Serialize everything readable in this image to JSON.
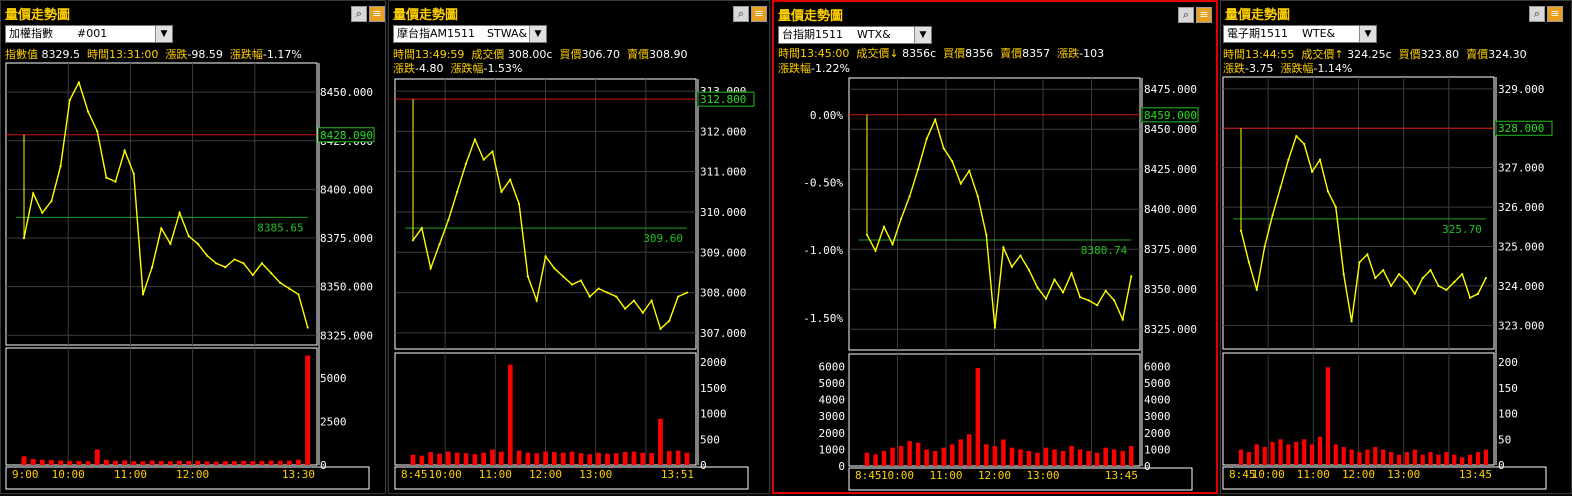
{
  "panels": [
    {
      "title": "量價走勢圖",
      "selector": {
        "name": "加權指數",
        "symbol": "#001"
      },
      "info_line1": [
        {
          "label": "指數值",
          "value": "8329.5"
        },
        {
          "label": "時間",
          "value": "13:31:00"
        },
        {
          "label": "漲跌",
          "value": "-98.59"
        },
        {
          "label": "漲跌幅",
          "value": "-1.17%"
        }
      ],
      "info_line2": [],
      "price_ticks": [
        "8450.000",
        "8425.000",
        "8400.000",
        "8375.000",
        "8350.000",
        "8325.000"
      ],
      "ref_label": "8428.090",
      "avg_label": "8385.65",
      "volume_ticks": [
        "5000",
        "2500",
        "0"
      ],
      "time_labels": [
        "9:00",
        "10:00",
        "11:00",
        "12:00",
        "13:30"
      ]
    },
    {
      "title": "量價走勢圖",
      "selector": {
        "name": "摩台指AM1511",
        "symbol": "STWA&"
      },
      "info_line1": [
        {
          "label": "時間",
          "value": "13:49:59"
        },
        {
          "label": "成交價",
          "value": "308.00c"
        },
        {
          "label": "買價",
          "value": "306.70"
        },
        {
          "label": "賣價",
          "value": "308.90"
        }
      ],
      "info_line2": [
        {
          "label": "漲跌",
          "value": "-4.80"
        },
        {
          "label": "漲跌幅",
          "value": "-1.53%"
        }
      ],
      "price_ticks": [
        "313.000",
        "312.000",
        "311.000",
        "310.000",
        "309.000",
        "308.000",
        "307.000"
      ],
      "ref_label": "312.800",
      "avg_label": "309.60",
      "volume_ticks": [
        "2000",
        "1500",
        "1000",
        "500",
        "0"
      ],
      "time_labels": [
        "8:45",
        "10:00",
        "11:00",
        "12:00",
        "13:00",
        "13:51"
      ]
    },
    {
      "title": "量價走勢圖",
      "selector": {
        "name": "台指期1511",
        "symbol": "WTX&"
      },
      "info_line1": [
        {
          "label": "時間",
          "value": "13:45:00"
        },
        {
          "label": "成交價↓",
          "value": "8356c"
        },
        {
          "label": "買價",
          "value": "8356"
        },
        {
          "label": "賣價",
          "value": "8357"
        },
        {
          "label": "漲跌",
          "value": "-103"
        }
      ],
      "info_line2": [
        {
          "label": "漲跌幅",
          "value": "-1.22%"
        }
      ],
      "price_ticks": [
        "8475.000",
        "8450.000",
        "8425.000",
        "8400.000",
        "8375.000",
        "8350.000",
        "8325.000"
      ],
      "pct_ticks": [
        "0.00%",
        "-0.50%",
        "-1.00%",
        "-1.50%"
      ],
      "ref_label": "8459.000",
      "avg_label": "8380.74",
      "volume_ticks": [
        "6000",
        "5000",
        "4000",
        "3000",
        "2000",
        "1000",
        "0"
      ],
      "time_labels": [
        "8:45",
        "10:00",
        "11:00",
        "12:00",
        "13:00",
        "13:45"
      ]
    },
    {
      "title": "量價走勢圖",
      "selector": {
        "name": "電子期1511",
        "symbol": "WTE&"
      },
      "info_line1": [
        {
          "label": "時間",
          "value": "13:44:55"
        },
        {
          "label": "成交價↑",
          "value": "324.25c"
        },
        {
          "label": "買價",
          "value": "323.80"
        },
        {
          "label": "賣價",
          "value": "324.30"
        }
      ],
      "info_line2": [
        {
          "label": "漲跌",
          "value": "-3.75"
        },
        {
          "label": "漲跌幅",
          "value": "-1.14%"
        }
      ],
      "price_ticks": [
        "329.000",
        "328.000",
        "327.000",
        "326.000",
        "325.000",
        "324.000",
        "323.000"
      ],
      "ref_label": "328.000",
      "avg_label": "325.70",
      "volume_ticks": [
        "200",
        "150",
        "100",
        "50",
        "0"
      ],
      "time_labels": [
        "8:45",
        "10:00",
        "11:00",
        "12:00",
        "13:00",
        "13:45"
      ]
    }
  ],
  "chart_data": [
    {
      "type": "line",
      "title": "",
      "xlabel": "",
      "ylabel": "",
      "x_range": [
        "9:00",
        "13:30"
      ],
      "ylim": [
        8320,
        8465
      ],
      "reference": 8428.09,
      "average": 8385.65,
      "series": [
        {
          "values": [
            8375,
            8398,
            8388,
            8394,
            8412,
            8446,
            8455,
            8440,
            8430,
            8406,
            8404,
            8420,
            8408,
            8346,
            8360,
            8380,
            8372,
            8388,
            8376,
            8372,
            8366,
            8362,
            8360,
            8364,
            8362,
            8356,
            8362,
            8357,
            8352,
            8349,
            8346,
            8329
          ]
        }
      ],
      "volume": {
        "ylim": [
          0,
          6500
        ],
        "values": [
          500,
          350,
          300,
          280,
          260,
          240,
          230,
          220,
          900,
          300,
          240,
          260,
          220,
          210,
          260,
          230,
          220,
          250,
          230,
          240,
          210,
          200,
          220,
          230,
          240,
          220,
          230,
          260,
          240,
          250,
          300,
          6300
        ]
      },
      "colors": {
        "price": "#ffff00",
        "volume": "#ff0000",
        "reference": "#d01818",
        "average": "#20a020"
      }
    },
    {
      "type": "line",
      "title": "",
      "xlabel": "",
      "ylabel": "",
      "x_range": [
        "8:45",
        "13:51"
      ],
      "ylim": [
        306.6,
        313.3
      ],
      "reference": 312.8,
      "average": 309.6,
      "series": [
        {
          "values": [
            309.3,
            309.6,
            308.6,
            309.2,
            309.8,
            310.5,
            311.2,
            311.8,
            311.3,
            311.5,
            310.5,
            310.8,
            310.2,
            308.4,
            307.8,
            308.9,
            308.6,
            308.4,
            308.2,
            308.3,
            307.9,
            308.1,
            308.0,
            307.9,
            307.6,
            307.8,
            307.5,
            307.8,
            307.1,
            307.3,
            307.9,
            308.0
          ]
        }
      ],
      "volume": {
        "ylim": [
          0,
          2100
        ],
        "values": [
          200,
          180,
          250,
          220,
          260,
          240,
          230,
          210,
          240,
          300,
          260,
          1950,
          280,
          240,
          230,
          260,
          250,
          240,
          260,
          230,
          210,
          240,
          220,
          230,
          250,
          260,
          240,
          230,
          900,
          270,
          280,
          240
        ]
      },
      "colors": {
        "price": "#ffff00",
        "volume": "#ff0000",
        "reference": "#d01818",
        "average": "#20a020"
      }
    },
    {
      "type": "line",
      "title": "",
      "xlabel": "",
      "ylabel": "",
      "x_range": [
        "8:45",
        "13:45"
      ],
      "ylim": [
        8312,
        8482
      ],
      "reference": 8459.0,
      "average": 8380.74,
      "series": [
        {
          "values": [
            8384,
            8374,
            8389,
            8378,
            8394,
            8408,
            8425,
            8444,
            8456,
            8438,
            8430,
            8416,
            8424,
            8408,
            8384,
            8326,
            8376,
            8364,
            8371,
            8362,
            8351,
            8344,
            8356,
            8348,
            8360,
            8345,
            8343,
            8340,
            8349,
            8343,
            8331,
            8358
          ]
        }
      ],
      "volume": {
        "ylim": [
          0,
          6500
        ],
        "values": [
          800,
          700,
          900,
          1100,
          1200,
          1500,
          1400,
          1000,
          900,
          1100,
          1300,
          1600,
          1900,
          5900,
          1300,
          1200,
          1600,
          1100,
          1000,
          900,
          800,
          1100,
          1000,
          900,
          1200,
          1000,
          900,
          800,
          1100,
          1000,
          900,
          1200
        ]
      },
      "colors": {
        "price": "#ffff00",
        "volume": "#ff0000",
        "reference": "#d01818",
        "average": "#20a020"
      }
    },
    {
      "type": "line",
      "title": "",
      "xlabel": "",
      "ylabel": "",
      "x_range": [
        "8:45",
        "13:45"
      ],
      "ylim": [
        322.4,
        329.3
      ],
      "reference": 328.0,
      "average": 325.7,
      "series": [
        {
          "values": [
            325.4,
            324.6,
            323.9,
            325.0,
            325.8,
            326.5,
            327.2,
            327.8,
            327.6,
            326.9,
            327.2,
            326.4,
            326.0,
            324.3,
            323.1,
            324.6,
            324.8,
            324.2,
            324.4,
            324.0,
            324.3,
            324.1,
            323.8,
            324.2,
            324.4,
            324.0,
            323.9,
            324.1,
            324.3,
            323.7,
            323.8,
            324.2
          ]
        }
      ],
      "volume": {
        "ylim": [
          0,
          210
        ],
        "values": [
          30,
          25,
          40,
          35,
          45,
          50,
          40,
          45,
          50,
          40,
          55,
          190,
          40,
          35,
          30,
          25,
          30,
          35,
          30,
          25,
          20,
          25,
          30,
          20,
          25,
          20,
          25,
          20,
          15,
          20,
          25,
          30
        ]
      },
      "colors": {
        "price": "#ffff00",
        "volume": "#ff0000",
        "reference": "#d01818",
        "average": "#20a020"
      }
    }
  ]
}
